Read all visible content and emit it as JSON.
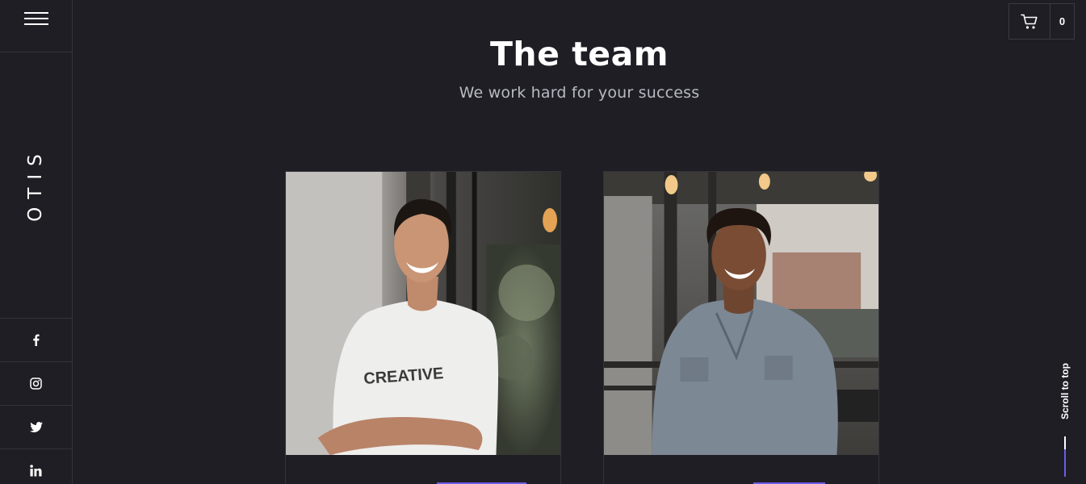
{
  "brand": {
    "name": "OTIS"
  },
  "header": {
    "cart_count": "0"
  },
  "section": {
    "title": "The team",
    "subtitle": "We work hard for your success"
  },
  "team": [
    {
      "shirt_text": "CREATIVE"
    },
    {}
  ],
  "social": [
    "facebook-icon",
    "instagram-icon",
    "twitter-icon",
    "linkedin-icon"
  ],
  "scroll_top": {
    "label": "Scroll to top"
  },
  "colors": {
    "background": "#1e1e24",
    "accent": "#6c5ce7",
    "border": "#33333b",
    "text": "#ffffff",
    "muted_text": "#b9b9c2"
  }
}
